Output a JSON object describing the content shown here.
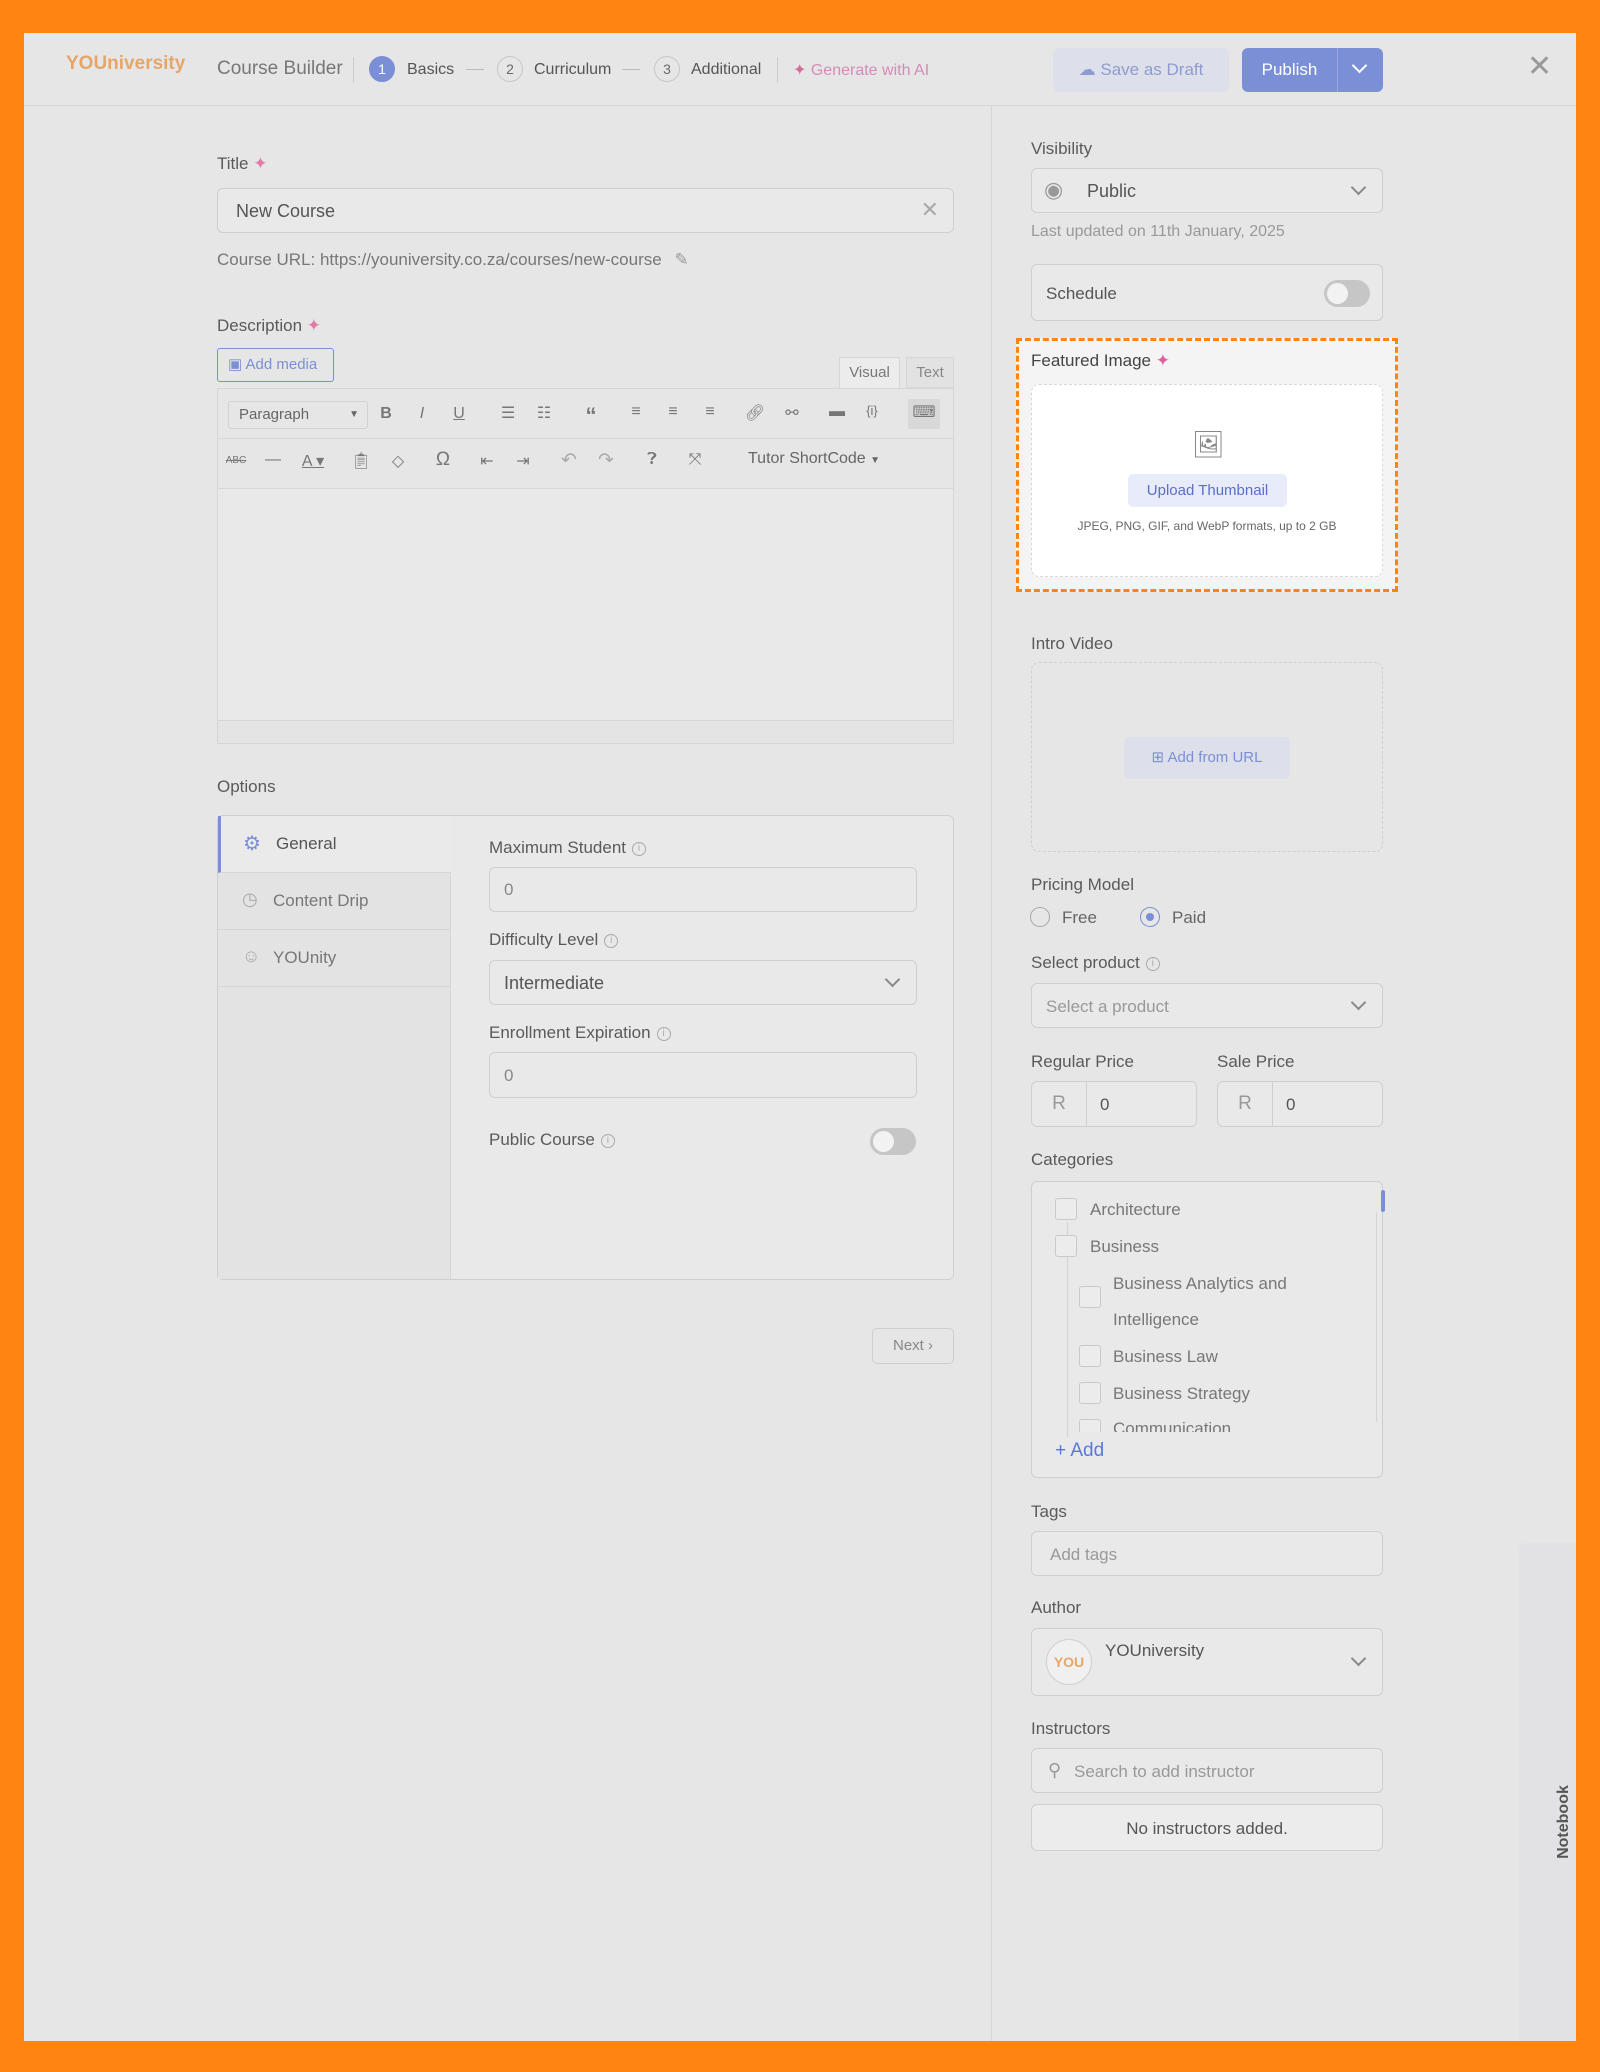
{
  "header": {
    "logo": "YOUniversity",
    "app_title": "Course Builder",
    "steps": [
      {
        "num": "1",
        "label": "Basics"
      },
      {
        "num": "2",
        "label": "Curriculum"
      },
      {
        "num": "3",
        "label": "Additional"
      }
    ],
    "generate_ai": "Generate with AI",
    "save_draft": "Save as Draft",
    "publish": "Publish"
  },
  "main": {
    "title_label": "Title",
    "title_value": "New Course",
    "course_url": "Course URL: https://youniversity.co.za/courses/new-course",
    "description_label": "Description",
    "add_media": "Add media",
    "editor_tabs": [
      "Visual",
      "Text"
    ],
    "format_select": "Paragraph",
    "shortcode": "Tutor ShortCode",
    "options_label": "Options",
    "option_tabs": [
      {
        "label": "General",
        "icon": "gear-icon"
      },
      {
        "label": "Content Drip",
        "icon": "clock-icon"
      },
      {
        "label": "YOUnity",
        "icon": "user-icon"
      }
    ],
    "max_student_label": "Maximum Student",
    "max_student_value": "0",
    "difficulty_label": "Difficulty Level",
    "difficulty_value": "Intermediate",
    "enrollment_label": "Enrollment Expiration",
    "enrollment_value": "0",
    "public_course_label": "Public Course",
    "public_course_on": false,
    "next": "Next"
  },
  "side": {
    "visibility_label": "Visibility",
    "visibility_value": "Public",
    "last_updated": "Last updated on 11th January, 2025",
    "schedule_label": "Schedule",
    "schedule_on": false,
    "featured_label": "Featured Image",
    "upload_thumbnail": "Upload Thumbnail",
    "formats": "JPEG, PNG, GIF, and WebP formats, up to 2 GB",
    "intro_video_label": "Intro Video",
    "add_from_url": "Add from URL",
    "pricing_label": "Pricing Model",
    "pricing_options": [
      "Free",
      "Paid"
    ],
    "pricing_selected": "Paid",
    "product_label": "Select product",
    "product_placeholder": "Select a product",
    "regular_price_label": "Regular Price",
    "sale_price_label": "Sale Price",
    "currency": "R",
    "regular_price": "0",
    "sale_price": "0",
    "categories_label": "Categories",
    "categories": [
      "Architecture",
      "Business",
      "Business Analytics and",
      "Intelligence",
      "Business Law",
      "Business Strategy",
      "Communication"
    ],
    "add_category": "Add",
    "tags_label": "Tags",
    "tags_placeholder": "Add tags",
    "author_label": "Author",
    "author_name": "YOUniversity",
    "author_avatar": "YOU",
    "instructors_label": "Instructors",
    "instructor_placeholder": "Search to add instructor",
    "no_instructors": "No instructors added."
  },
  "notebook": "Notebook",
  "colors": {
    "frame": "#ff8412",
    "accent": "#7b8fd6",
    "highlight": "#ff8412"
  }
}
